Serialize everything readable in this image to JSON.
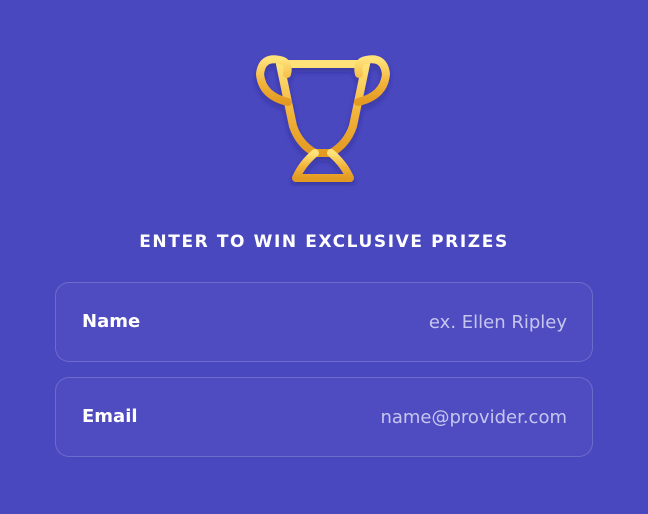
{
  "icon": "trophy-icon",
  "colors": {
    "background": "#4a48bf",
    "trophy_gold": "#f2b33a",
    "text": "#ffffff",
    "placeholder": "#d9d9f6"
  },
  "form": {
    "headline": "ENTER TO WIN EXCLUSIVE PRIZES",
    "name": {
      "label": "Name",
      "value": "",
      "placeholder": "ex. Ellen Ripley"
    },
    "email": {
      "label": "Email",
      "value": "",
      "placeholder": "name@provider.com"
    }
  }
}
